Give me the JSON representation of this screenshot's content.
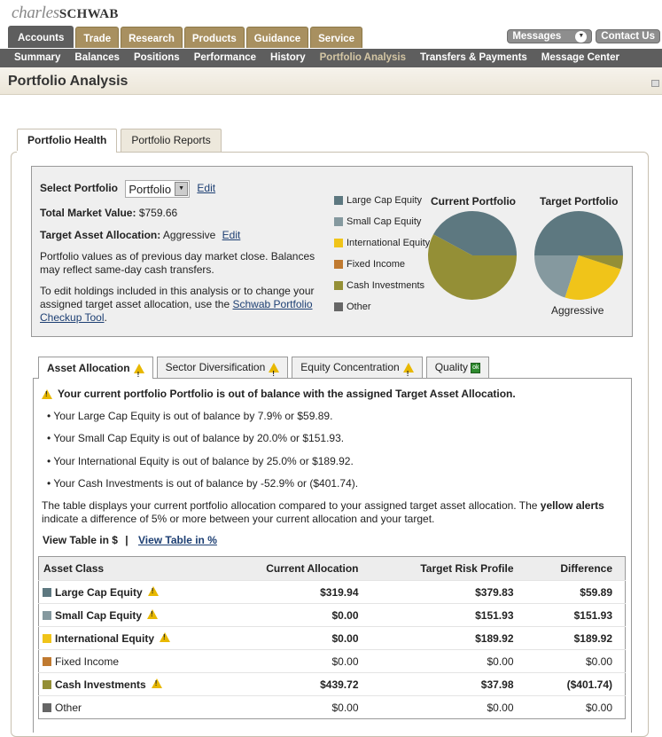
{
  "brand": {
    "first": "charles",
    "second": "SCHWAB"
  },
  "main_tabs": [
    {
      "label": "Accounts",
      "active": true
    },
    {
      "label": "Trade",
      "active": false
    },
    {
      "label": "Research",
      "active": false
    },
    {
      "label": "Products",
      "active": false
    },
    {
      "label": "Guidance",
      "active": false
    },
    {
      "label": "Service",
      "active": false
    }
  ],
  "top_buttons": {
    "messages": "Messages",
    "contact": "Contact Us"
  },
  "sub_nav": [
    {
      "label": "Summary"
    },
    {
      "label": "Balances"
    },
    {
      "label": "Positions"
    },
    {
      "label": "Performance"
    },
    {
      "label": "History"
    },
    {
      "label": "Portfolio Analysis",
      "active": true
    },
    {
      "label": "Transfers & Payments"
    },
    {
      "label": "Message Center"
    }
  ],
  "page_title": "Portfolio Analysis",
  "outer_tabs": [
    {
      "label": "Portfolio Health",
      "active": true
    },
    {
      "label": "Portfolio Reports"
    }
  ],
  "summary": {
    "select_label": "Select Portfolio",
    "select_value": "Portfolio",
    "edit": "Edit",
    "tmv_label": "Total Market Value:",
    "tmv_value": "$759.66",
    "taa_label": "Target Asset Allocation:",
    "taa_value": "Aggressive",
    "note1": "Portfolio values as of previous day market close. Balances may reflect same-day cash transfers.",
    "note2_pre": "To edit holdings included in this analysis or to change your assigned target asset allocation, use the ",
    "note2_link": "Schwab Portfolio Checkup Tool",
    "note2_post": "."
  },
  "colors": {
    "large_cap": "#5d7880",
    "small_cap": "#85999f",
    "international": "#f0c419",
    "fixed_income": "#c07a30",
    "cash": "#948f36",
    "other": "#666666"
  },
  "legend": [
    {
      "label": "Large Cap Equity",
      "key": "large_cap"
    },
    {
      "label": "Small Cap Equity",
      "key": "small_cap"
    },
    {
      "label": "International Equity",
      "key": "international"
    },
    {
      "label": "Fixed Income",
      "key": "fixed_income"
    },
    {
      "label": "Cash Investments",
      "key": "cash"
    },
    {
      "label": "Other",
      "key": "other"
    }
  ],
  "chart_data": [
    {
      "type": "pie",
      "title": "Current Portfolio",
      "labels": [
        "Large Cap Equity",
        "Small Cap Equity",
        "International Equity",
        "Fixed Income",
        "Cash Investments",
        "Other"
      ],
      "values": [
        319.94,
        0,
        0,
        0,
        439.72,
        0
      ]
    },
    {
      "type": "pie",
      "title": "Target Portfolio",
      "subtitle": "Aggressive",
      "labels": [
        "Large Cap Equity",
        "Small Cap Equity",
        "International Equity",
        "Fixed Income",
        "Cash Investments",
        "Other"
      ],
      "values": [
        379.83,
        151.93,
        189.92,
        0,
        37.98,
        0
      ]
    }
  ],
  "inner_tabs": [
    {
      "label": "Asset Allocation",
      "status": "warn",
      "active": true
    },
    {
      "label": "Sector Diversification",
      "status": "warn"
    },
    {
      "label": "Equity Concentration",
      "status": "warn"
    },
    {
      "label": "Quality",
      "status": "ok",
      "badge": "ok"
    }
  ],
  "alert": "Your current portfolio Portfolio is out of balance with the assigned Target Asset Allocation.",
  "bullets": [
    "• Your Large Cap Equity is out of balance by 7.9% or $59.89.",
    "• Your Small Cap Equity is out of balance by 20.0% or $151.93.",
    "• Your International Equity is out of balance by 25.0% or $189.92.",
    "• Your Cash Investments is out of balance by -52.9% or ($401.74)."
  ],
  "description": {
    "pre": "The table displays your current portfolio allocation compared to your assigned target asset allocation. The ",
    "bold": "yellow alerts",
    "post": " indicate a difference of 5% or more between your current allocation and your target."
  },
  "view_links": {
    "dollars": "View Table in $",
    "sep": "|",
    "percent": "View Table in %"
  },
  "table": {
    "headers": [
      "Asset Class",
      "Current Allocation",
      "Target Risk Profile",
      "Difference"
    ],
    "rows": [
      {
        "key": "large_cap",
        "asset": "Large Cap Equity",
        "warn": true,
        "current": "$319.94",
        "target": "$379.83",
        "diff": "$59.89"
      },
      {
        "key": "small_cap",
        "asset": "Small Cap Equity",
        "warn": true,
        "current": "$0.00",
        "target": "$151.93",
        "diff": "$151.93"
      },
      {
        "key": "international",
        "asset": "International Equity",
        "warn": true,
        "current": "$0.00",
        "target": "$189.92",
        "diff": "$189.92"
      },
      {
        "key": "fixed_income",
        "asset": "Fixed Income",
        "warn": false,
        "current": "$0.00",
        "target": "$0.00",
        "diff": "$0.00"
      },
      {
        "key": "cash",
        "asset": "Cash Investments",
        "warn": true,
        "current": "$439.72",
        "target": "$37.98",
        "diff": "($401.74)"
      },
      {
        "key": "other",
        "asset": "Other",
        "warn": false,
        "current": "$0.00",
        "target": "$0.00",
        "diff": "$0.00"
      }
    ]
  }
}
